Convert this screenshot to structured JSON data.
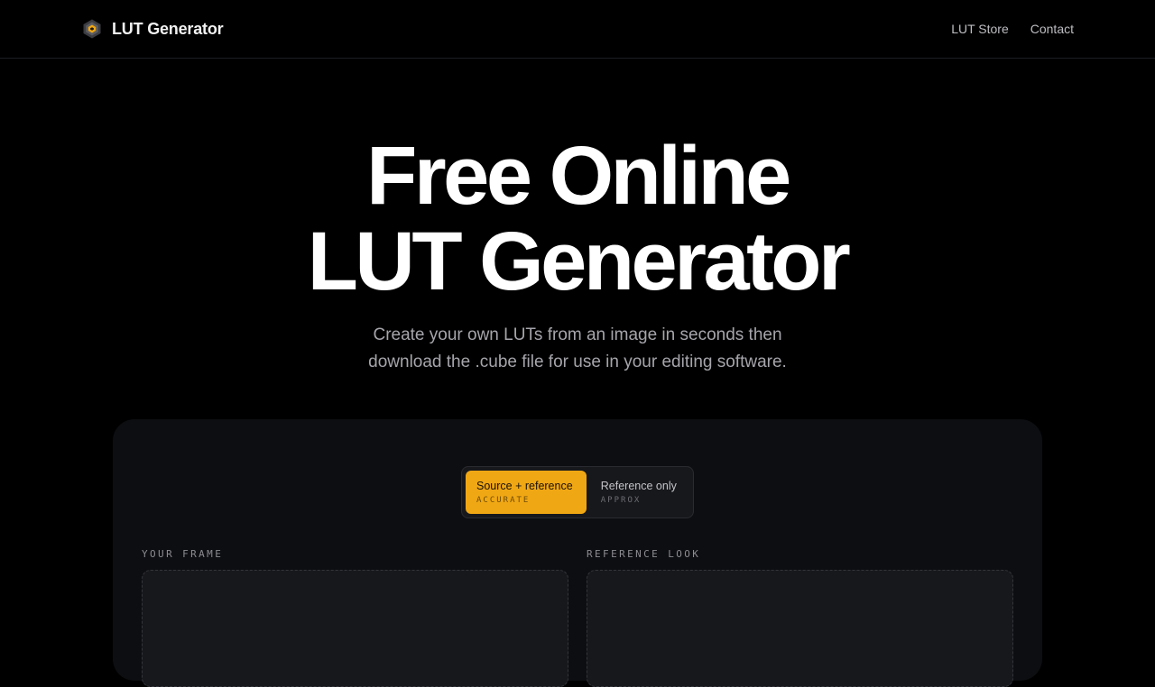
{
  "header": {
    "brand_name": "LUT Generator",
    "logo_icon": "hexagon-logo-icon",
    "nav": [
      {
        "label": "LUT Store"
      },
      {
        "label": "Contact"
      }
    ]
  },
  "hero": {
    "title_line1": "Free Online",
    "title_line2": "LUT Generator",
    "subtitle": "Create your own LUTs from an image in seconds then download the .cube file for use in your editing software."
  },
  "mode_switch": {
    "options": [
      {
        "label": "Source + reference",
        "tag": "ACCURATE",
        "selected": true
      },
      {
        "label": "Reference only",
        "tag": "APPROX",
        "selected": false
      }
    ]
  },
  "upload": {
    "source_label": "YOUR FRAME",
    "reference_label": "REFERENCE LOOK"
  },
  "colors": {
    "accent": "#f0a714",
    "background": "#000000",
    "panel": "#0d0e11"
  }
}
